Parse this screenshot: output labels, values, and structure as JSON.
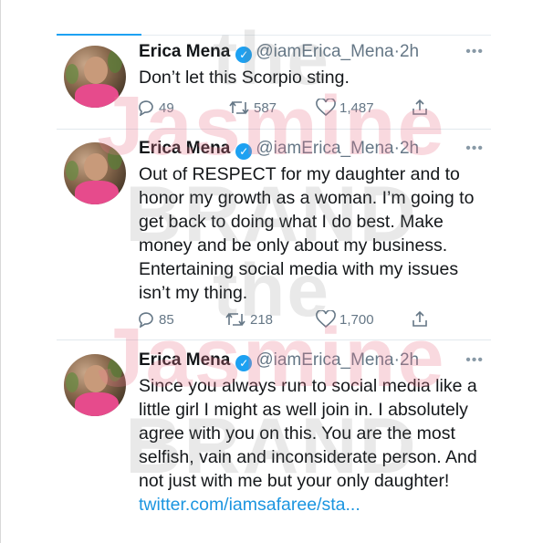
{
  "watermark": {
    "word_the": "the",
    "word_jasmine": "Jasmine",
    "word_brand": "BRAND"
  },
  "tweets": [
    {
      "name": "Erica Mena",
      "handle": "@iamErica_Mena",
      "separator": "·",
      "time": "2h",
      "more": "•••",
      "text": "Don’t let this Scorpio sting.",
      "link": "",
      "replies": "49",
      "retweets": "587",
      "likes": "1,487"
    },
    {
      "name": "Erica Mena",
      "handle": "@iamErica_Mena",
      "separator": "·",
      "time": "2h",
      "more": "•••",
      "text": "Out of RESPECT for my daughter and to honor my growth as a woman. I’m going to get back to doing what I do best. Make money and be only about my business. Entertaining social media with my issues isn’t my thing.",
      "link": "",
      "replies": "85",
      "retweets": "218",
      "likes": "1,700"
    },
    {
      "name": "Erica Mena",
      "handle": "@iamErica_Mena",
      "separator": "·",
      "time": "2h",
      "more": "•••",
      "text": "Since you always run to social media like a little girl I might as well join in. I absolutely agree with you on this. You are the most selfish, vain and inconsiderate person. And not just with me but your only daughter!",
      "link": "twitter.com/iamsafaree/sta...",
      "replies": "",
      "retweets": "",
      "likes": ""
    }
  ],
  "colors": {
    "accent": "#1da1f2",
    "link": "#1b95e0",
    "muted": "#657786"
  }
}
